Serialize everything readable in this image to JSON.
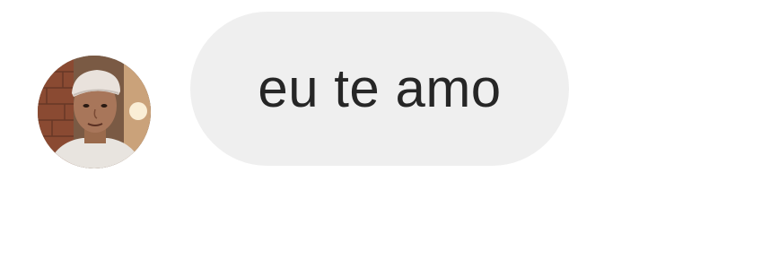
{
  "conversation": {
    "messages": [
      {
        "avatar_icon": "user-photo-avatar",
        "text": "eu te amo",
        "bubble_color": "#efefef",
        "text_color": "#262626"
      }
    ]
  }
}
